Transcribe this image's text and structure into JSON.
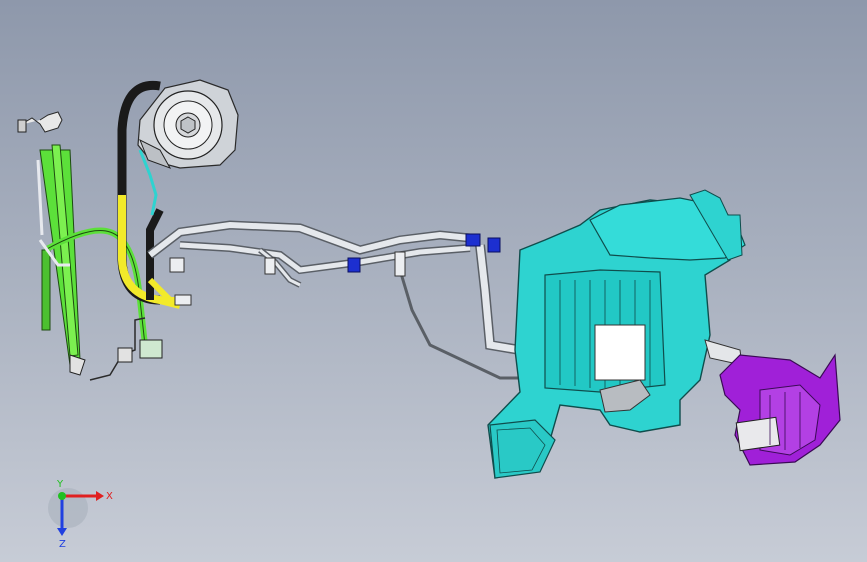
{
  "viewport": {
    "background_top": "#8e98ab",
    "background_bottom": "#c7ccd6"
  },
  "colors": {
    "hvac_body": "#2ed3d0",
    "hvac_dark": "#1aa8a6",
    "blower_purple": "#a020d8",
    "pipe_gray": "#d9dde3",
    "hose_black": "#1a1a1a",
    "hose_yellow": "#f2ea2a",
    "bracket_green": "#5ce03a",
    "clamp_blue": "#1c2fd0",
    "compressor_gray": "#cfd3d8"
  },
  "components": {
    "compressor": "compressor-icon",
    "condenser_lines": "green-bracket-icon",
    "refrigerant_pipes": "pipe-icon",
    "hvac_unit": "hvac-unit-icon",
    "blower": "blower-icon"
  },
  "triad": {
    "x_label": "X",
    "y_label": "Y",
    "z_label": "Z",
    "x_color": "#e02020",
    "y_color": "#20c020",
    "z_color": "#2040e0"
  }
}
